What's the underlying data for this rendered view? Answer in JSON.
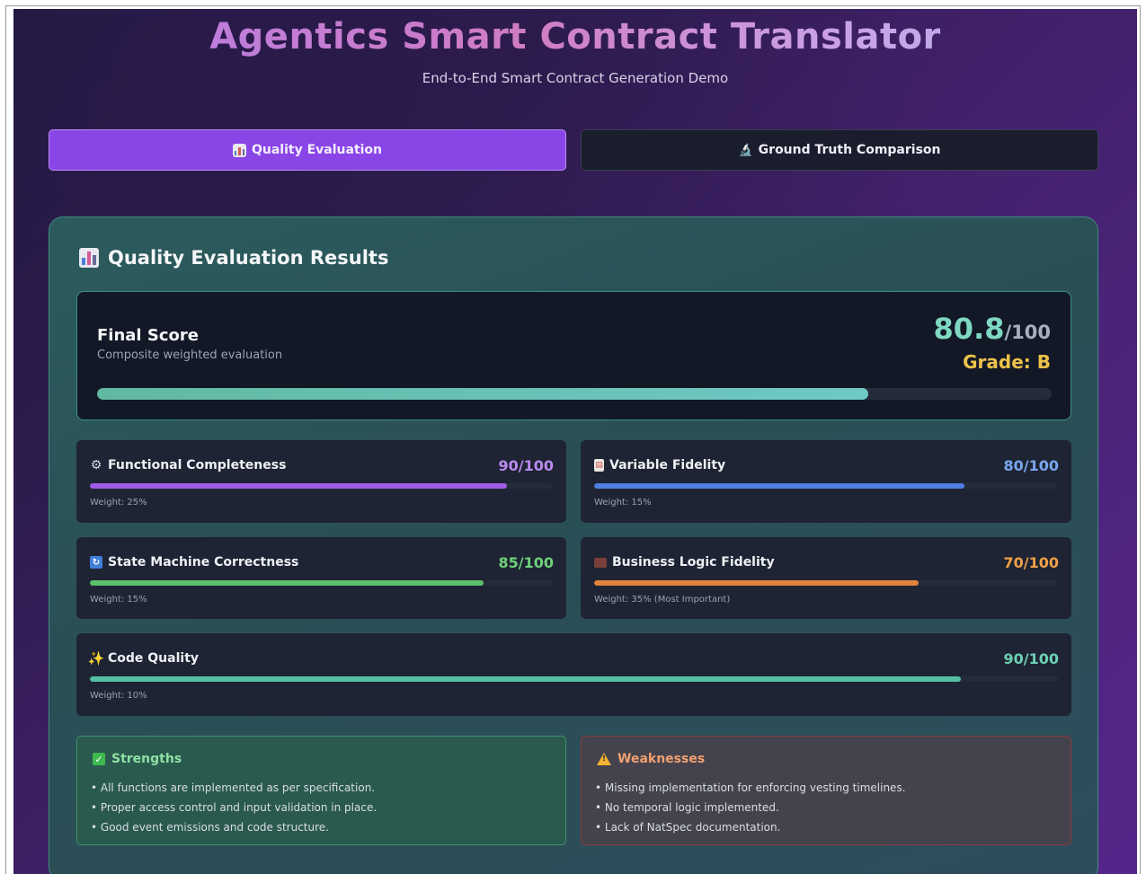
{
  "header": {
    "title": "Agentics Smart Contract Translator",
    "subtitle": "End-to-End Smart Contract Generation Demo"
  },
  "tabs": [
    {
      "label": "Quality Evaluation",
      "icon": "bar-chart-icon",
      "active": true
    },
    {
      "label": "Ground Truth Comparison",
      "icon": "microscope-icon",
      "active": false
    }
  ],
  "panel": {
    "title": "Quality Evaluation Results",
    "icon": "bar-chart-icon"
  },
  "final_score": {
    "label": "Final Score",
    "sub": "Composite weighted evaluation",
    "score": "80.8",
    "max": "/100",
    "grade": "Grade: B",
    "progress": 0.808,
    "color": "#6ec9c6"
  },
  "metrics": [
    {
      "name": "Functional Completeness",
      "icon": "gear-icon",
      "score": "90/100",
      "progress": 0.9,
      "weight": "Weight: 25%",
      "color": "#a05ce6",
      "score_color": "#b98af0"
    },
    {
      "name": "Variable Fidelity",
      "icon": "document-icon",
      "score": "80/100",
      "progress": 0.8,
      "weight": "Weight: 15%",
      "color": "#4f7fe0",
      "score_color": "#79a6ef"
    },
    {
      "name": "State Machine Correctness",
      "icon": "refresh-icon",
      "score": "85/100",
      "progress": 0.85,
      "weight": "Weight: 15%",
      "color": "#5cc06a",
      "score_color": "#6fd07a"
    },
    {
      "name": "Business Logic Fidelity",
      "icon": "briefcase-icon",
      "score": "70/100",
      "progress": 0.7,
      "weight": "Weight: 35% (Most Important)",
      "color": "#e0823a",
      "score_color": "#f0a048"
    },
    {
      "name": "Code Quality",
      "icon": "sparkles-icon",
      "score": "90/100",
      "progress": 0.9,
      "weight": "Weight: 10%",
      "color": "#55bfa3",
      "score_color": "#6dd1b4"
    }
  ],
  "strengths": {
    "title": "Strengths",
    "items": [
      "• All functions are implemented as per specification.",
      "• Proper access control and input validation in place.",
      "• Good event emissions and code structure."
    ]
  },
  "weaknesses": {
    "title": "Weaknesses",
    "items": [
      "• Missing implementation for enforcing vesting timelines.",
      "• No temporal logic implemented.",
      "• Lack of NatSpec documentation."
    ]
  }
}
